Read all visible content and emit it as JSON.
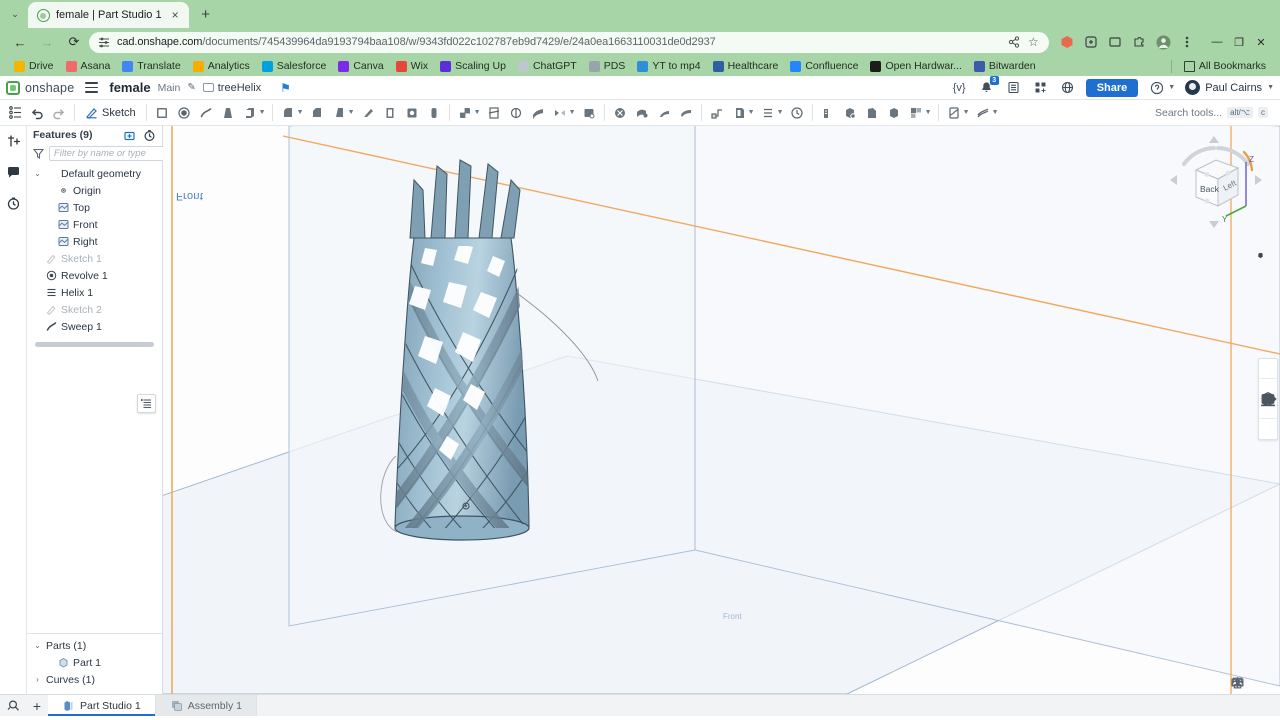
{
  "browser": {
    "tab": {
      "title": "female | Part Studio 1",
      "favicon": "onshape-favicon",
      "close": "×"
    },
    "new_tab": "+",
    "tab_list_caret": "⌄",
    "nav": {
      "back": "←",
      "forward": "→",
      "reload": "⟳"
    },
    "omnibox": {
      "url_main": "cad.onshape.com",
      "url_path": "/documents/745439964da9193794baa108/w/9343fd022c102787eb9d7429/e/24a0ea1663110031de0d2937",
      "site_settings_icon": "tune-icon",
      "share_icon": "share-icon",
      "bookmark_star": "☆"
    },
    "window_controls": {
      "minimize": "—",
      "maximize": "❐",
      "close": "✕"
    },
    "bookmarks": [
      {
        "label": "Drive",
        "color": "#f5b400"
      },
      {
        "label": "Asana",
        "color": "#f06a6a"
      },
      {
        "label": "Translate",
        "color": "#4285f4"
      },
      {
        "label": "Analytics",
        "color": "#f9ab00"
      },
      {
        "label": "Salesforce",
        "color": "#00a1e0"
      },
      {
        "label": "Canva",
        "color": "#7d2ae8"
      },
      {
        "label": "Wix",
        "color": "#e8453c"
      },
      {
        "label": "Scaling Up",
        "color": "#5b2ddb"
      },
      {
        "label": "ChatGPT",
        "color": "#bfc6cc"
      },
      {
        "label": "PDS",
        "color": "#9aa4ad"
      },
      {
        "label": "YT to mp4",
        "color": "#2f8fd6"
      },
      {
        "label": "Healthcare",
        "color": "#2e5fa3"
      },
      {
        "label": "Confluence",
        "color": "#2684ff"
      },
      {
        "label": "Open Hardwar...",
        "color": "#1c1c1c"
      },
      {
        "label": "Bitwarden",
        "color": "#3b5ca8"
      }
    ],
    "all_bookmarks": "All Bookmarks"
  },
  "onshape": {
    "brand": "onshape",
    "document_name": "female",
    "branch": "Main",
    "workspace_tab": "treeHelix",
    "topbar_icons": [
      "featurescript-icon",
      "notifications-icon",
      "list-icon",
      "apps-grid-icon",
      "globe-icon"
    ],
    "notification_count": "3",
    "share_label": "Share",
    "help_icon": "help-icon",
    "user_name": "Paul Cairns",
    "toolbar": {
      "sketch_label": "Sketch",
      "search_placeholder": "Search tools...",
      "search_shortcut_alt": "alt/⌥",
      "search_shortcut_key": "c",
      "items": [
        "feature-list-icon",
        "undo-icon",
        "redo-icon",
        "sketch-icon",
        "plane-icon",
        "revolve-icon",
        "sweep-icon",
        "loft-icon",
        "extrude-icon",
        "fillet-icon",
        "chamfer-icon",
        "draft-icon",
        "rib-icon",
        "shell-icon",
        "hole-icon",
        "thread-icon",
        "boolean-icon",
        "split-icon",
        "transform-icon",
        "mirror-icon",
        "pattern-icon",
        "helix-icon",
        "curve-icon",
        "surface-icon",
        "delete-face-icon",
        "move-face-icon",
        "replace-face-icon",
        "enclose-icon",
        "variable-icon",
        "measure-icon",
        "mass-icon",
        "sketch-pattern-icon",
        "assembly-icon",
        "configuration-icon",
        "version-icon"
      ]
    },
    "panel": {
      "title": "Features (9)",
      "header_icons": [
        "insert-feature-icon",
        "rollback-icon"
      ],
      "filter_placeholder": "Filter by name or type",
      "filter_icon": "funnel-icon",
      "tree": [
        {
          "label": "Default geometry",
          "icon": "folder-icon",
          "level": 0,
          "chevron": "⌄",
          "muted": false
        },
        {
          "label": "Origin",
          "icon": "origin-icon",
          "level": 1,
          "chevron": "",
          "muted": false
        },
        {
          "label": "Top",
          "icon": "plane-icon",
          "level": 1,
          "chevron": "",
          "muted": false
        },
        {
          "label": "Front",
          "icon": "plane-icon",
          "level": 1,
          "chevron": "",
          "muted": false
        },
        {
          "label": "Right",
          "icon": "plane-icon",
          "level": 1,
          "chevron": "",
          "muted": false
        },
        {
          "label": "Sketch 1",
          "icon": "sketch-icon",
          "level": 0,
          "chevron": "",
          "muted": true
        },
        {
          "label": "Revolve 1",
          "icon": "revolve-icon",
          "level": 0,
          "chevron": "",
          "muted": false
        },
        {
          "label": "Helix 1",
          "icon": "helix-icon",
          "level": 0,
          "chevron": "",
          "muted": false
        },
        {
          "label": "Sketch 2",
          "icon": "sketch-icon",
          "level": 0,
          "chevron": "",
          "muted": true
        },
        {
          "label": "Sweep 1",
          "icon": "sweep-icon",
          "level": 0,
          "chevron": "",
          "muted": false
        }
      ],
      "parts": [
        {
          "label": "Parts (1)",
          "icon": "",
          "level": 0,
          "chevron": "⌄",
          "muted": false
        },
        {
          "label": "Part 1",
          "icon": "part-icon",
          "level": 1,
          "chevron": "",
          "muted": false
        },
        {
          "label": "Curves (1)",
          "icon": "",
          "level": 0,
          "chevron": "›",
          "muted": false
        }
      ]
    },
    "rail_icons": [
      "insert-part-icon",
      "comment-icon",
      "history-icon"
    ],
    "panel_toggle_icon": "panel-list-icon",
    "viewcube": {
      "front_face": "Back",
      "side_face": "Left",
      "plane_label": "Front",
      "axis_z": "Z",
      "axis_y": "Y"
    },
    "display_style_icon": "display-style-icon",
    "right_tools": [
      "appearance-icon",
      "section-view-icon",
      "render-icon",
      "export-icon"
    ],
    "bottom_right_tools": [
      "print-icon",
      "gauge-icon",
      "compare-icon"
    ],
    "bottom_tabs": {
      "search_icon": "tab-search-icon",
      "add": "+",
      "tabs": [
        {
          "label": "Part Studio 1",
          "icon": "part-studio-icon",
          "active": true
        },
        {
          "label": "Assembly 1",
          "icon": "assembly-icon",
          "active": false
        }
      ]
    }
  },
  "colors": {
    "browser_chrome": "#a8d5a8",
    "accent_blue": "#1f6fd0",
    "model_fill": "#8fb3c7",
    "plane_edge": "#9fb6cf",
    "axis_orange": "#f0a860"
  }
}
